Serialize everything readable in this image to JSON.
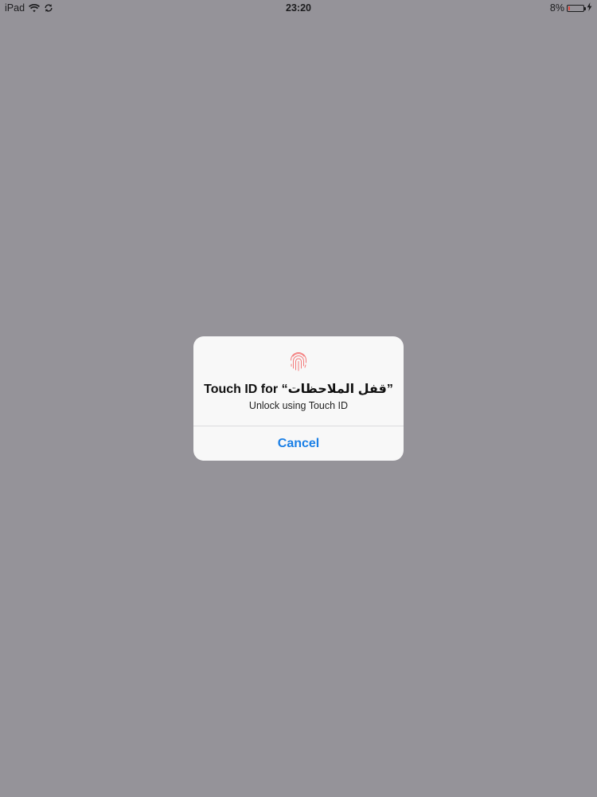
{
  "status_bar": {
    "device": "iPad",
    "time": "23:20",
    "battery_percent": "8%",
    "battery_level": 0.08,
    "icons": [
      "wifi-icon",
      "sync-icon",
      "battery-icon",
      "charging-bolt-icon"
    ]
  },
  "dialog": {
    "icon": "fingerprint-icon",
    "title": "Touch ID for “قفل الملاحظات”",
    "message": "Unlock using Touch ID",
    "cancel_label": "Cancel"
  },
  "colors": {
    "backdrop": "#959399",
    "dialog_bg": "#f8f8f8",
    "accent": "#1a7fe6",
    "fingerprint": "#f47a7a",
    "battery_low": "#e5473d"
  }
}
